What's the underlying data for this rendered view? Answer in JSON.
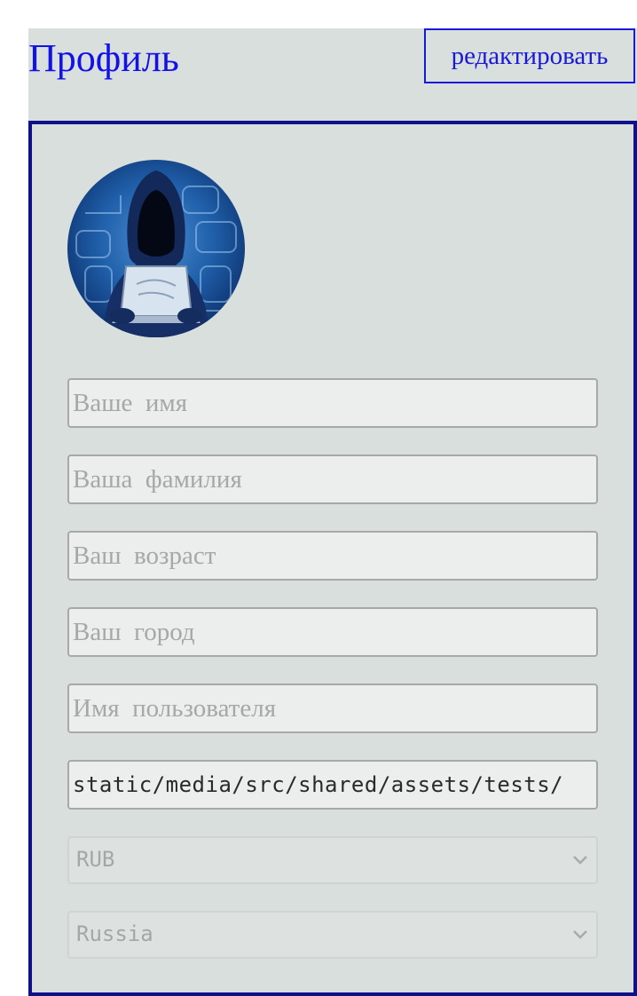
{
  "header": {
    "title": "Профиль",
    "edit_label": "редактировать"
  },
  "avatar": {
    "description_icon": "hooded-hacker-avatar"
  },
  "form": {
    "first_name": {
      "value": "",
      "placeholder": "Ваше  имя"
    },
    "last_name": {
      "value": "",
      "placeholder": "Ваша  фамилия"
    },
    "age": {
      "value": "",
      "placeholder": "Ваш  возраст"
    },
    "city": {
      "value": "",
      "placeholder": "Ваш  город"
    },
    "username": {
      "value": "",
      "placeholder": "Имя  пользователя"
    },
    "image_path": {
      "value": "static/media/src/shared/assets/tests/"
    },
    "currency": {
      "selected": "RUB"
    },
    "country": {
      "selected": "Russia"
    }
  },
  "colors": {
    "accent": "#1a1ad6",
    "card_border": "#10108a",
    "background": "#d9dfdd"
  }
}
